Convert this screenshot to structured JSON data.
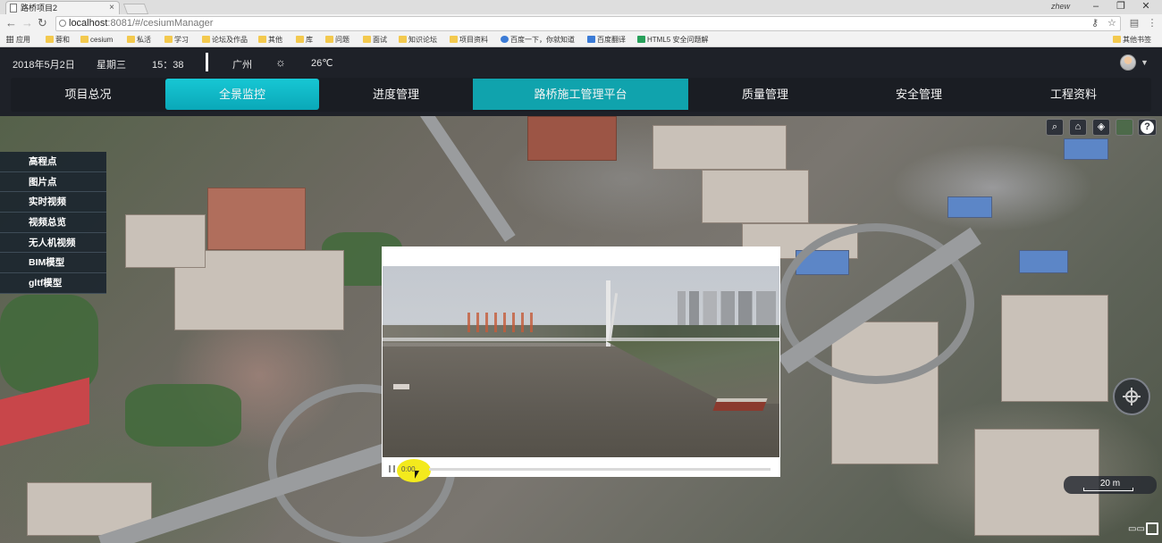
{
  "browser": {
    "tab_title": "路桥项目2",
    "tab_close": "×",
    "user": "zhew",
    "win_minimize": "–",
    "win_restore": "❐",
    "win_close": "✕",
    "url_host": "localhost",
    "url_path": ":8081/#/cesiumManager",
    "bookmarks": [
      "应用",
      "蓉和",
      "cesium",
      "私活",
      "学习",
      "论坛及作品",
      "其他",
      "库",
      "问题",
      "面试",
      "知识论坛",
      "项目资料",
      "百度一下，你就知道",
      "百度翻译",
      "HTML5 安全问题解",
      "其他书签"
    ]
  },
  "header": {
    "date": "2018年5月2日",
    "weekday": "星期三",
    "time": "15：38",
    "city": "广州",
    "weather_icon": "☼",
    "temperature": "26℃"
  },
  "nav": {
    "items": [
      "项目总况",
      "全景监控",
      "进度管理",
      "路桥施工管理平台",
      "质量管理",
      "安全管理",
      "工程资料"
    ],
    "active_index": 1
  },
  "layers": {
    "items": [
      "高程点",
      "图片点",
      "实时视频",
      "视频总览",
      "无人机视频",
      "BIM模型",
      "gltf模型"
    ]
  },
  "toolbar": {
    "search_icon": "⌕",
    "home_icon": "⌂",
    "layers_icon": "◈",
    "help_label": "?"
  },
  "video": {
    "time": "0:00",
    "progress": 0
  },
  "map": {
    "scale_label": "20 m"
  },
  "colors": {
    "accent": "#10a3ad",
    "active_tab": "#17c7d4",
    "header_bg": "#1e2128"
  }
}
